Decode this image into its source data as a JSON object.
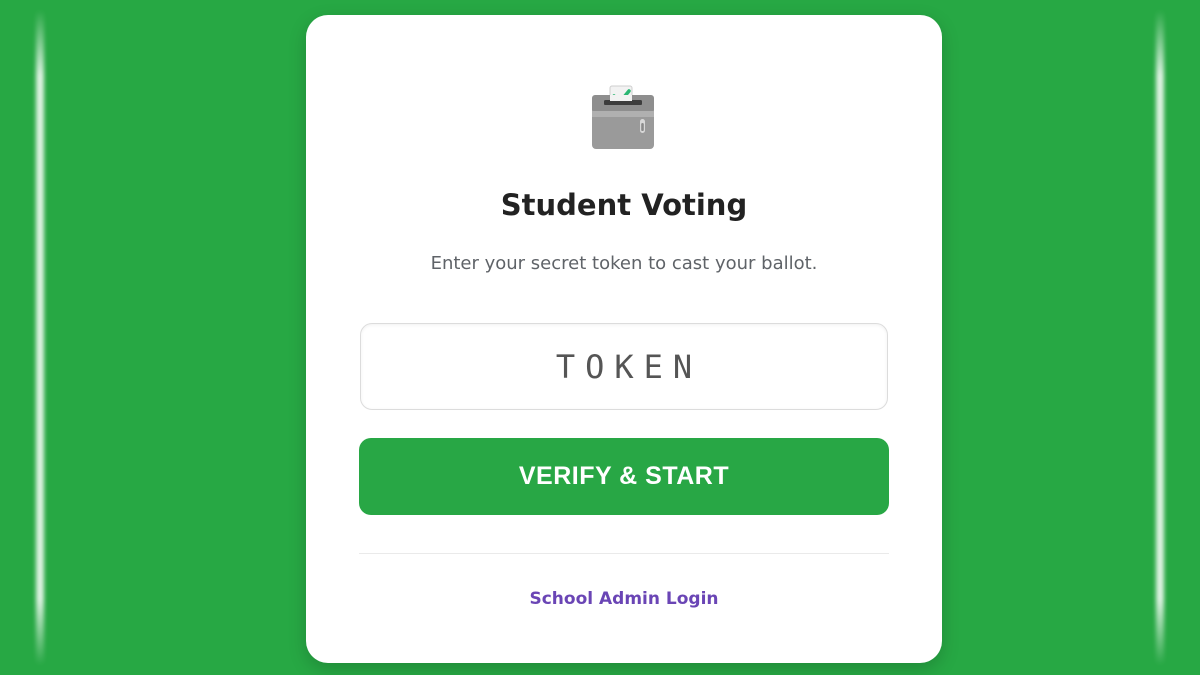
{
  "page": {
    "title": "Student Voting",
    "subtitle": "Enter your secret token to cast your ballot.",
    "icon": "ballot-box-with-check-icon"
  },
  "form": {
    "token_placeholder": "TOKEN",
    "token_value": "",
    "submit_label": "VERIFY & START"
  },
  "footer": {
    "admin_link_label": "School Admin Login"
  },
  "colors": {
    "background": "#27a844",
    "button": "#28a745",
    "link": "#6a45b5",
    "check": "#2bb673"
  }
}
